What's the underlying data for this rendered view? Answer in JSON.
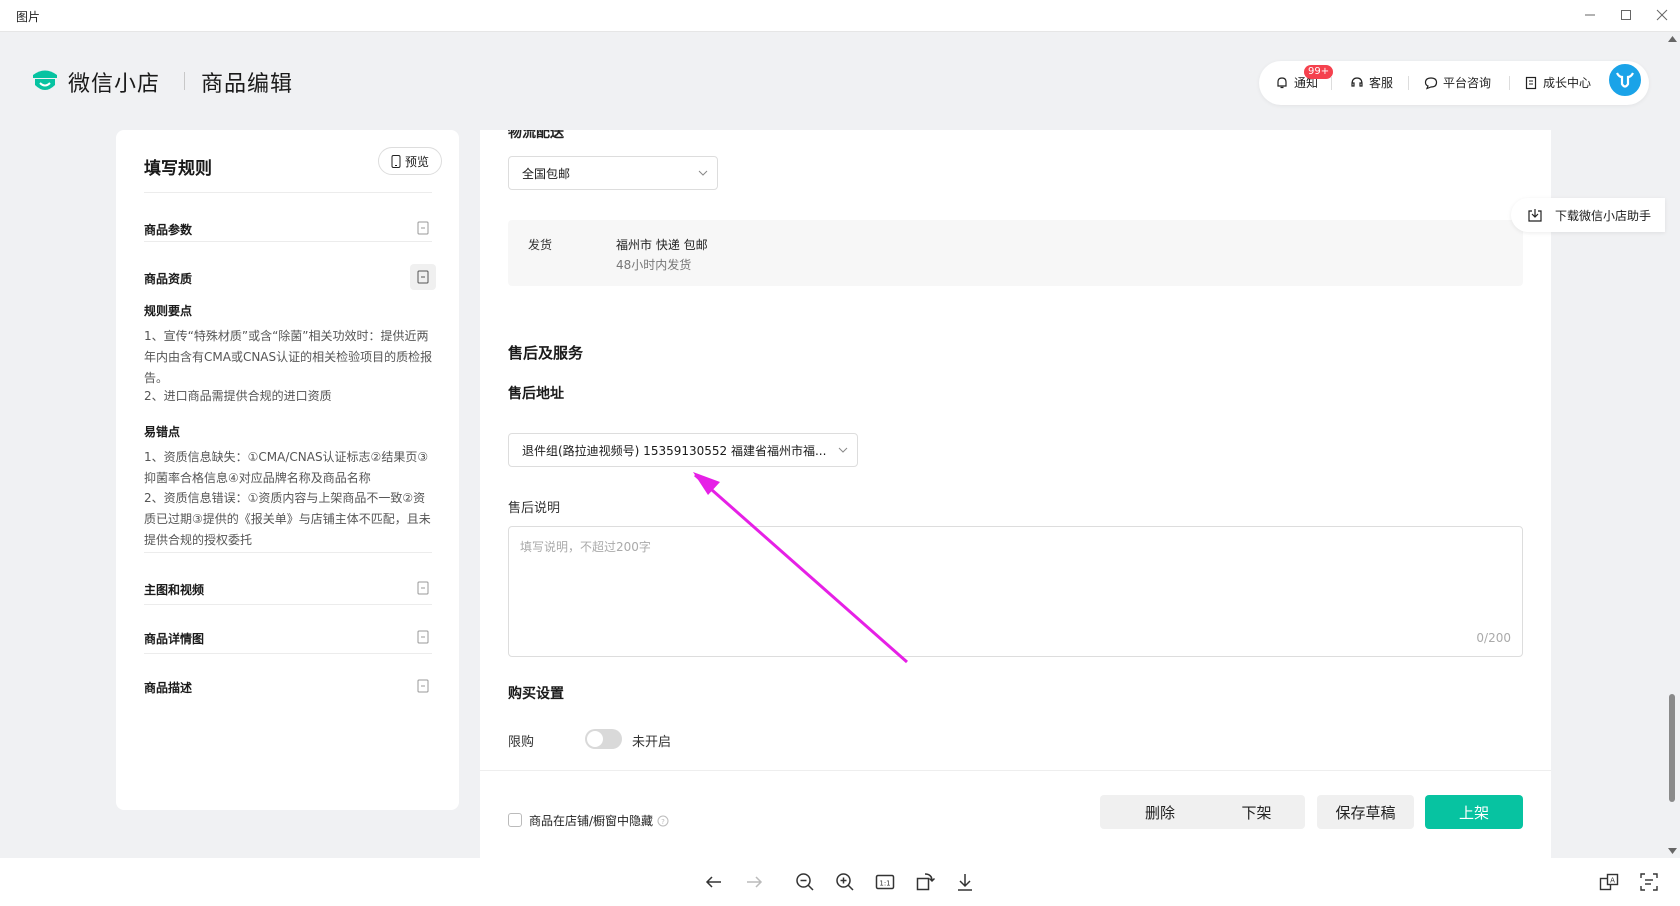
{
  "window": {
    "title": "图片",
    "controls": [
      "minimize",
      "maximize",
      "close"
    ]
  },
  "header": {
    "brand": "微信小店",
    "page_title": "商品编辑",
    "nav": {
      "notify": "通知",
      "notify_badge": "99+",
      "service": "客服",
      "consult": "平台咨询",
      "growth": "成长中心"
    },
    "avatar_icon": "avatar-bull"
  },
  "rules": {
    "title": "填写规则",
    "preview": "预览",
    "items": [
      {
        "label": "商品参数"
      },
      {
        "label": "商品资质"
      },
      {
        "label": "主图和视频"
      },
      {
        "label": "商品详情图"
      },
      {
        "label": "商品描述"
      }
    ],
    "key_points_title": "规则要点",
    "key_points_1": "1、宣传“特殊材质”或含“除菌”相关功效时：提供近两年内由含有CMA或CNAS认证的相关检验项目的质检报告。",
    "key_points_2": "2、进口商品需提供合规的进口资质",
    "errors_title": "易错点",
    "errors_1": "1、资质信息缺失：①CMA/CNAS认证标志②结果页③抑菌率合格信息④对应品牌名称及商品名称",
    "errors_2": "2、资质信息错误：①资质内容与上架商品不一致②资质已过期③提供的《报关单》与店铺主体不匹配，且未提供合规的授权委托"
  },
  "main": {
    "cut_heading": "物流配送",
    "shipping_select": "全国包邮",
    "ship_label": "发货",
    "ship_line1": "福州市 快递 包邮",
    "ship_line2": "48小时内发货",
    "after_sales_title": "售后及服务",
    "address_title": "售后地址",
    "address_select": "退件组(路拉迪视频号) 15359130552 福建省福州市福...",
    "desc_label": "售后说明",
    "desc_placeholder": "填写说明，不超过200字",
    "desc_counter": "0/200",
    "purchase_title": "购买设置",
    "limit_label": "限购",
    "limit_status": "未开启",
    "limit_enabled": false
  },
  "footer": {
    "hide_label": "商品在店铺/橱窗中隐藏",
    "hide_checked": false,
    "delete": "删除",
    "off_shelf": "下架",
    "save_draft": "保存草稿",
    "on_shelf": "上架"
  },
  "float": {
    "download_helper": "下载微信小店助手"
  },
  "colors": {
    "accent": "#07c3a1",
    "badge": "#f5414e",
    "annotation_arrow": "#e620e6"
  }
}
